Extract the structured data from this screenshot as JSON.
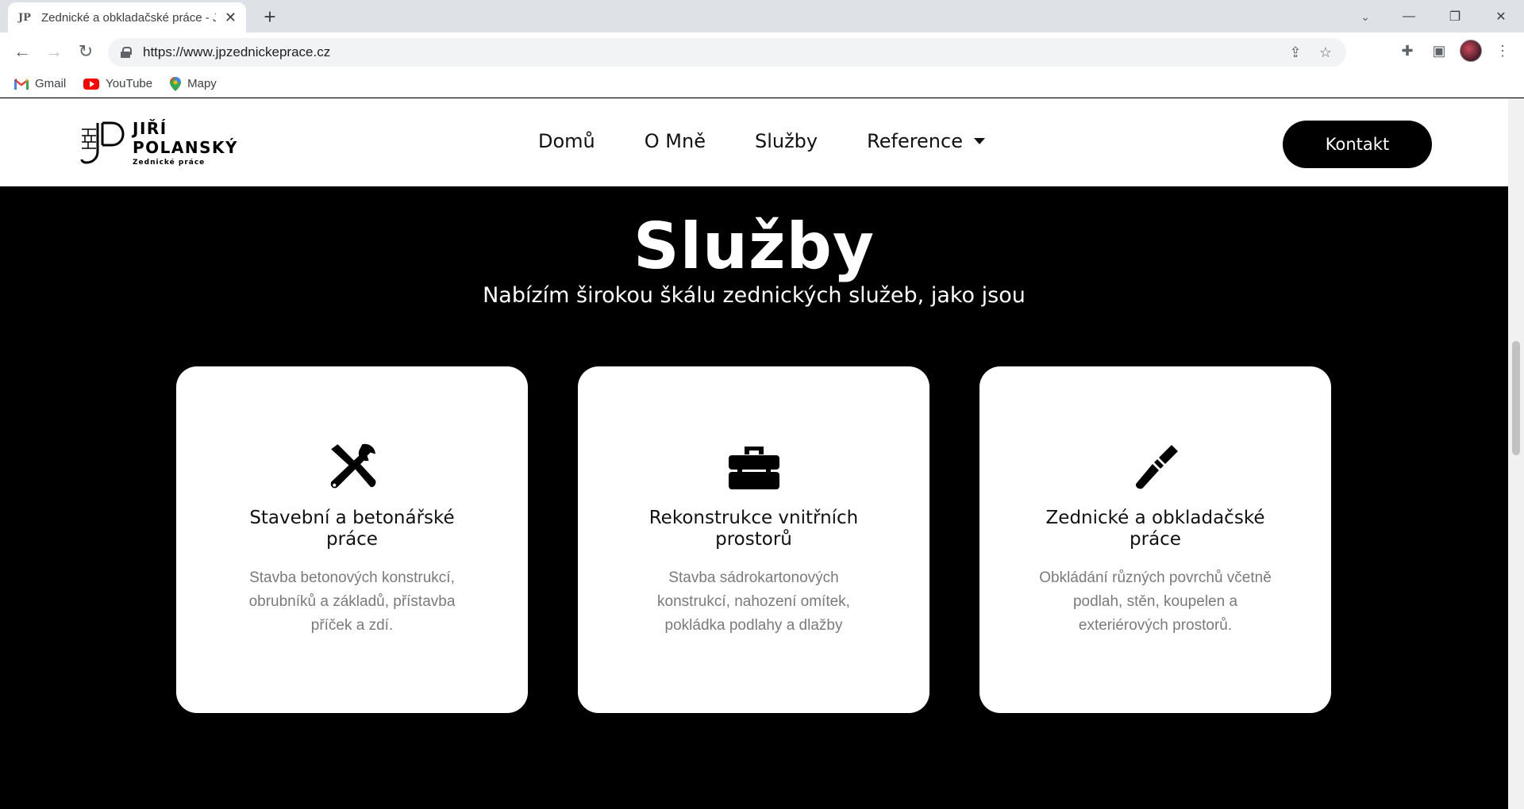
{
  "browser": {
    "tab_title": "Zednické a obkladačské práce - J",
    "url": "https://www.jpzednickeprace.cz",
    "bookmarks": [
      {
        "label": "Gmail",
        "icon": "gmail-icon"
      },
      {
        "label": "YouTube",
        "icon": "youtube-icon"
      },
      {
        "label": "Mapy",
        "icon": "maps-icon"
      }
    ]
  },
  "site": {
    "logo": {
      "mark": "JP",
      "name_line1": "JIŘÍ",
      "name_line2": "POLANSKÝ",
      "tagline": "Zednické práce"
    },
    "nav": [
      "Domů",
      "O Mně",
      "Služby",
      "Reference"
    ],
    "contact_button": "Kontakt"
  },
  "services": {
    "title": "Služby",
    "subtitle": "Nabízím širokou škálu zednických služeb, jako jsou",
    "cards": [
      {
        "icon": "tools-icon",
        "title": "Stavební a betonářské práce",
        "text": "Stavba betonových konstrukcí, obrubníků a základů, přístavba příček a zdí."
      },
      {
        "icon": "toolbox-icon",
        "title": "Rekonstrukce vnitřních prostorů",
        "text": "Stavba sádrokartonových konstrukcí, nahození omítek, pokládka podlahy a dlažby"
      },
      {
        "icon": "screwdriver-icon",
        "title": "Zednické a obkladačské práce",
        "text": "Obkládání různých povrchů včetně podlah, stěn, koupelen a exteriérových prostorů."
      }
    ]
  }
}
